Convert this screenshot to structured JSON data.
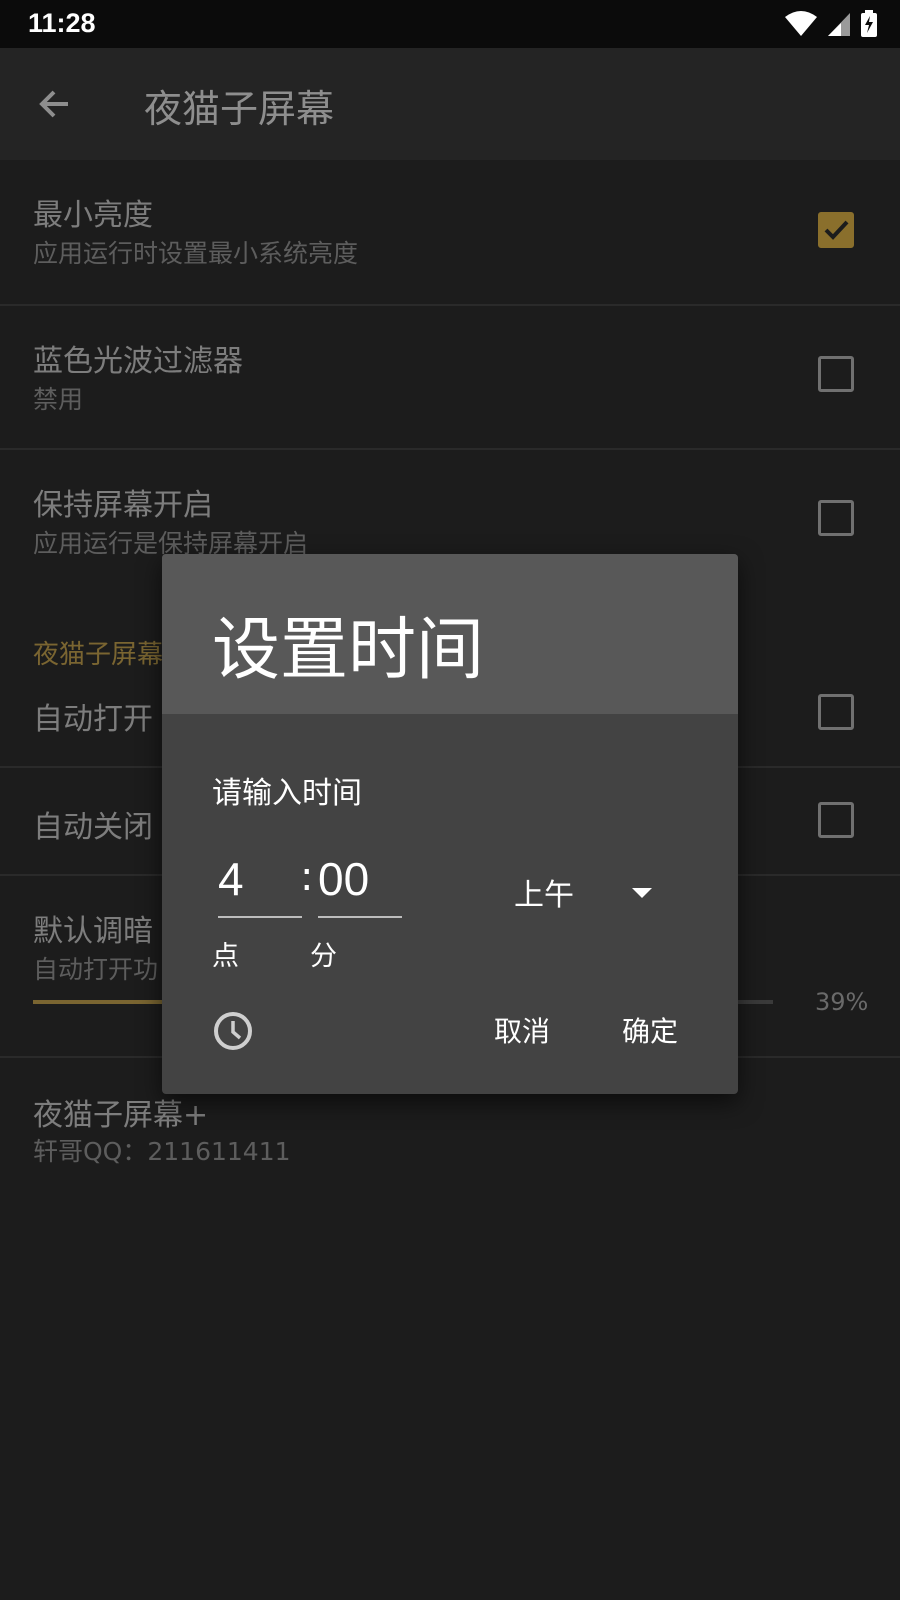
{
  "status": {
    "time": "11:28"
  },
  "appbar": {
    "title": "夜猫子屏幕"
  },
  "prefs": [
    {
      "title": "最小亮度",
      "summary": "应用运行时设置最小系统亮度",
      "checked": true
    },
    {
      "title": "蓝色光波过滤器",
      "summary": "禁用",
      "checked": false
    },
    {
      "title": "保持屏幕开启",
      "summary": "应用运行是保持屏幕开启",
      "checked": false
    }
  ],
  "section_header": "夜猫子屏幕",
  "auto": [
    {
      "title": "自动打开",
      "checked": false
    },
    {
      "title": "自动关闭",
      "checked": false
    }
  ],
  "dim": {
    "title": "默认调暗",
    "summary": "自动打开功",
    "value_text": "39%",
    "progress_fraction": 0.39
  },
  "about": {
    "title": "夜猫子屏幕+",
    "summary": "轩哥QQ：211611411"
  },
  "dialog": {
    "title": "设置时间",
    "prompt": "请输入时间",
    "hour": "4",
    "minute": "00",
    "separator": ":",
    "hour_label": "点",
    "minute_label": "分",
    "ampm": "上午",
    "cancel": "取消",
    "ok": "确定"
  },
  "colors": {
    "accent": "#8a6f2c",
    "dialog_bg": "#434343",
    "dialog_header": "#585858"
  },
  "icons": [
    "back-arrow-icon",
    "wifi-icon",
    "signal-icon",
    "battery-icon",
    "check-icon",
    "dropdown-arrow-icon",
    "clock-icon"
  ]
}
